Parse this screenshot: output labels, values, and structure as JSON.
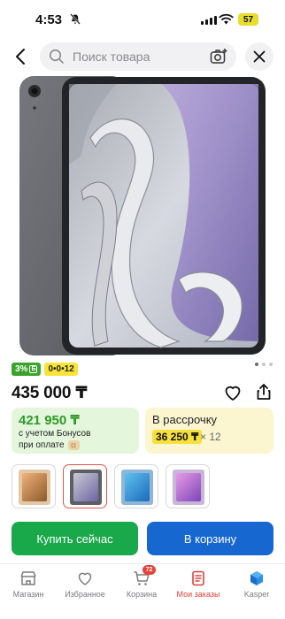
{
  "status_bar": {
    "time": "4:53",
    "battery": "57"
  },
  "search": {
    "placeholder": "Поиск товара"
  },
  "product": {
    "price": "435 000 ₸",
    "cashback_badge": "3%",
    "installment_badge": "0•0•12",
    "colors": {
      "accent_green": "#19a84a",
      "accent_blue": "#1767d1",
      "accent_red": "#e0413a"
    }
  },
  "bonus_card": {
    "value": "421 950 ₸",
    "line1": "с учетом Бонусов",
    "line2": "при оплате"
  },
  "installment_card": {
    "title": "В рассрочку",
    "amount": "36 250 ₸",
    "multiplier": "× 12"
  },
  "variants": [
    {
      "color": "starlight"
    },
    {
      "color": "space-gray",
      "selected": true
    },
    {
      "color": "blue"
    },
    {
      "color": "purple"
    }
  ],
  "buttons": {
    "buy_now": "Купить сейчас",
    "add_to_cart": "В корзину"
  },
  "nav": {
    "items": [
      {
        "label": "Магазин",
        "icon": "shop-icon"
      },
      {
        "label": "Избранное",
        "icon": "heart-icon"
      },
      {
        "label": "Корзина",
        "icon": "cart-icon",
        "badge": "72"
      },
      {
        "label": "Мои заказы",
        "icon": "orders-icon",
        "active": true
      },
      {
        "label": "Kasper",
        "icon": "kasper-icon"
      }
    ]
  }
}
